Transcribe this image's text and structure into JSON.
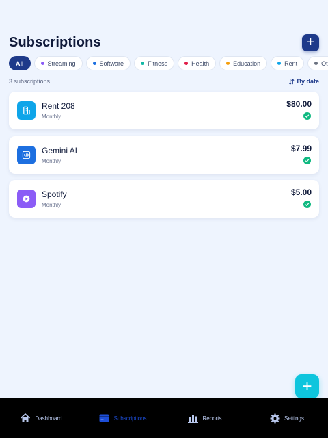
{
  "header": {
    "title": "Subscriptions",
    "add_label": "+"
  },
  "filters": [
    {
      "label": "All",
      "active": true
    },
    {
      "label": "Streaming",
      "dot": "#8b5cf6"
    },
    {
      "label": "Software",
      "dot": "#1d6fe0"
    },
    {
      "label": "Fitness",
      "dot": "#14b8a6"
    },
    {
      "label": "Health",
      "dot": "#e11d48"
    },
    {
      "label": "Education",
      "dot": "#f59e0b"
    },
    {
      "label": "Rent",
      "dot": "#0ea5e9"
    },
    {
      "label": "Other",
      "dot": "#6b7280"
    }
  ],
  "summary": {
    "count": "3 subscriptions",
    "sort": "By date",
    "sort_icon": "sort-icon"
  },
  "subscriptions": [
    {
      "name": "Rent 208",
      "frequency": "Monthly",
      "price": "$80.00",
      "icon": "building-icon",
      "color": "#0ea5e9",
      "status": "paid"
    },
    {
      "name": "Gemini AI",
      "frequency": "Monthly",
      "price": "$7.99",
      "icon": "code-icon",
      "color": "#1d6fe0",
      "status": "paid"
    },
    {
      "name": "Spotify",
      "frequency": "Monthly",
      "price": "$5.00",
      "icon": "play-icon",
      "color": "#8b5cf6",
      "status": "paid"
    }
  ],
  "fab": {
    "label": "+"
  },
  "nav": [
    {
      "label": "Dashboard",
      "icon": "home-icon"
    },
    {
      "label": "Subscriptions",
      "icon": "card-icon",
      "active": true
    },
    {
      "label": "Reports",
      "icon": "bar-chart-icon"
    },
    {
      "label": "Settings",
      "icon": "gear-icon"
    }
  ],
  "colors": {
    "accent": "#1e3a8a",
    "fab": "#0ec5dd",
    "background": "#eef4fe",
    "success": "#10b981"
  }
}
